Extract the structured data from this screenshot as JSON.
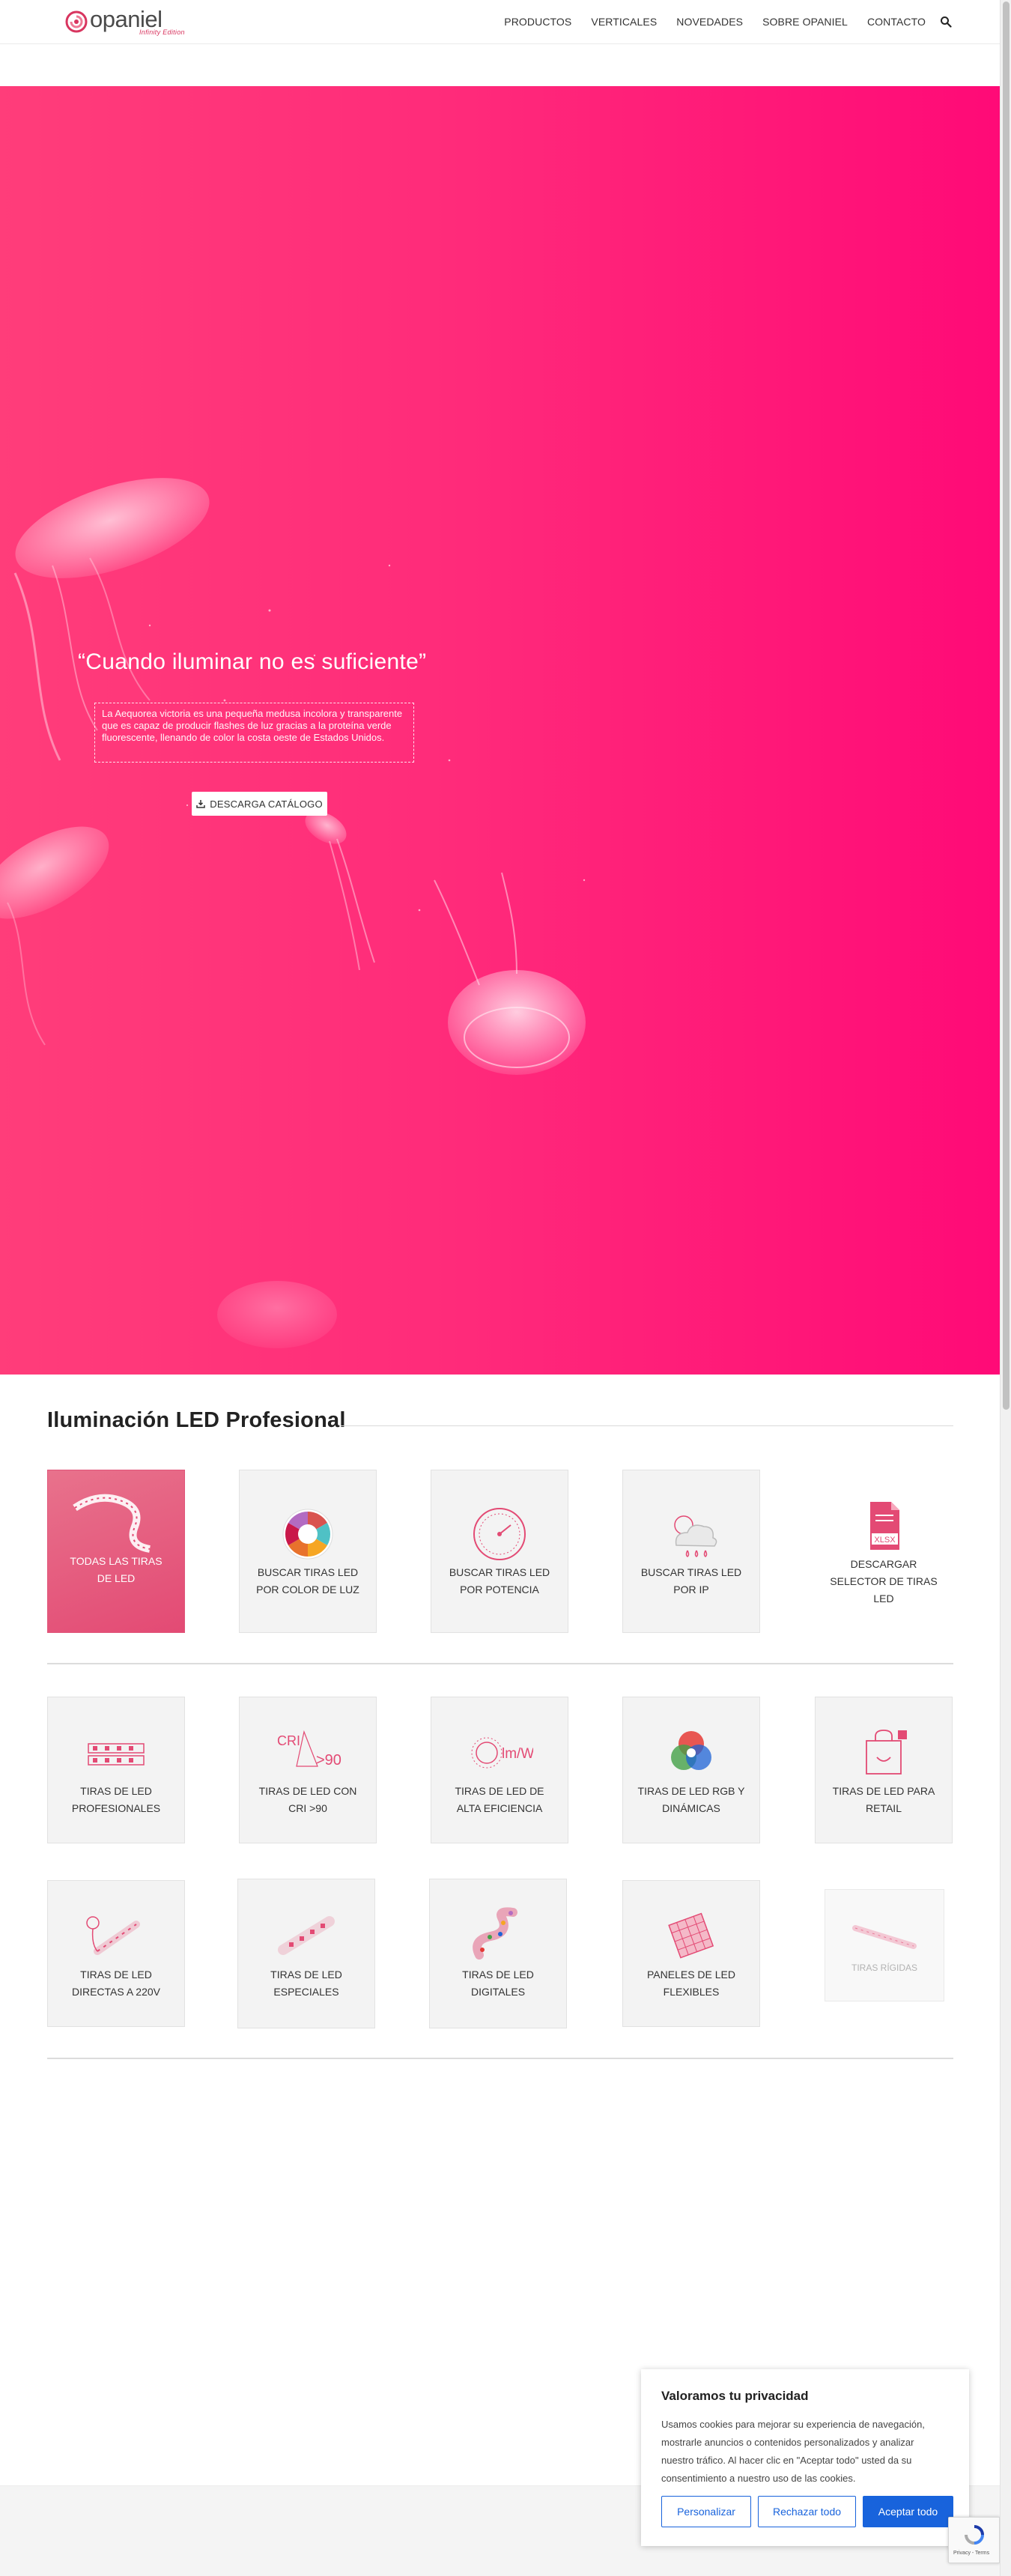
{
  "header": {
    "logo_word": "opaniel",
    "logo_tag": "Infinity Edition",
    "nav": [
      "PRODUCTOS",
      "VERTICALES",
      "NOVEDADES",
      "SOBRE OPANIEL",
      "CONTACTO"
    ],
    "search_icon": "search-icon"
  },
  "hero": {
    "title": "“Cuando iluminar no es suficiente”",
    "description": "La Aequorea victoria es una pequeña medusa incolora y transparente que es capaz de producir flashes de luz gracias a la proteína verde fluorescente, llenando de color la costa oeste de Estados Unidos.",
    "button_label": "DESCARGA CATÁLOGO",
    "button_icon": "download-icon",
    "colors": {
      "start": "#ff3d7a",
      "end": "#ff0a77"
    }
  },
  "section": {
    "title": "Iluminación LED Profesional"
  },
  "cards_row1": [
    {
      "label": "TODAS LAS TIRAS DE LED",
      "icon": "led-strip-roll-icon"
    },
    {
      "label": "BUSCAR TIRAS LED POR COLOR DE LUZ",
      "icon": "color-wheel-icon"
    },
    {
      "label": "BUSCAR TIRAS LED POR POTENCIA",
      "icon": "power-gauge-icon"
    },
    {
      "label": "BUSCAR TIRAS LED POR IP",
      "icon": "weather-icon"
    },
    {
      "label": "DESCARGAR SELECTOR DE TIRAS LED",
      "icon": "xlsx-file-icon",
      "file_badge": "XLSX"
    }
  ],
  "cards_row2": [
    {
      "label": "TIRAS DE LED PROFESIONALES",
      "icon": "led-strip-icon"
    },
    {
      "label": "TIRAS DE LED CON CRI >90",
      "icon": "cri-icon",
      "icon_text_a": "CRI",
      "icon_text_b": ">90"
    },
    {
      "label": "TIRAS DE LED DE ALTA EFICIENCIA",
      "icon": "efficiency-icon",
      "icon_text": "lm/W"
    },
    {
      "label": "TIRAS DE LED RGB Y DINÁMICAS",
      "icon": "rgb-icon"
    },
    {
      "label": "TIRAS DE LED PARA RETAIL",
      "icon": "shopping-bag-icon"
    }
  ],
  "cards_row3": [
    {
      "label": "TIRAS DE LED DIRECTAS A 220V",
      "icon": "plug-strip-icon"
    },
    {
      "label": "TIRAS DE LED ESPECIALES",
      "icon": "special-strip-icon"
    },
    {
      "label": "TIRAS DE LED DIGITALES",
      "icon": "digital-strip-icon"
    },
    {
      "label": "PANELES DE LED FLEXIBLES",
      "icon": "led-panel-icon"
    },
    {
      "label": "TIRAS RÍGIDAS",
      "icon": "rigid-bar-icon"
    }
  ],
  "cookie": {
    "title": "Valoramos tu privacidad",
    "text": "Usamos cookies para mejorar su experiencia de navegación, mostrarle anuncios o contenidos personalizados y analizar nuestro tráfico. Al hacer clic en \"Aceptar todo\" usted da su consentimiento a nuestro uso de las cookies.",
    "customize": "Personalizar",
    "reject": "Rechazar todo",
    "accept": "Aceptar todo",
    "accent": "#1863dc"
  },
  "recaptcha": {
    "text": "Privacy - Terms"
  }
}
